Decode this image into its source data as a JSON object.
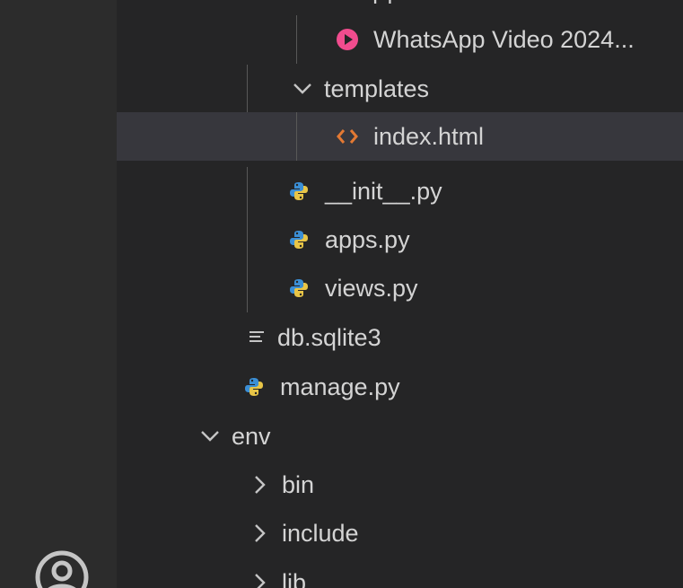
{
  "explorer": {
    "clipped_label": "[ ]",
    "rows": [
      {
        "label": "WhatsApp Video 2024...",
        "icon": "video-file-icon"
      },
      {
        "label": "templates",
        "icon": "chevron-down-icon",
        "expanded": true
      },
      {
        "label": "index.html",
        "icon": "html-file-icon",
        "selected": true
      },
      {
        "label": "__init__.py",
        "icon": "python-file-icon"
      },
      {
        "label": "apps.py",
        "icon": "python-file-icon"
      },
      {
        "label": "views.py",
        "icon": "python-file-icon"
      },
      {
        "label": "db.sqlite3",
        "icon": "text-file-icon"
      },
      {
        "label": "manage.py",
        "icon": "python-file-icon"
      },
      {
        "label": "env",
        "icon": "chevron-down-icon",
        "expanded": true
      },
      {
        "label": "bin",
        "icon": "chevron-right-icon",
        "expanded": false
      },
      {
        "label": "include",
        "icon": "chevron-right-icon",
        "expanded": false
      },
      {
        "label": "lib",
        "icon": "chevron-right-icon",
        "expanded": false
      }
    ]
  },
  "activity_bar": {
    "account_icon": "account-icon"
  },
  "colors": {
    "activity_bar_bg": "#2c2c2c",
    "sidebar_bg": "#252526",
    "selected_row_bg": "#37373d",
    "text": "#d4d4d4",
    "video_icon": "#f14c8e",
    "html_icon": "#e37933",
    "python_blue": "#3b8fd6",
    "python_yellow": "#e8c547"
  }
}
